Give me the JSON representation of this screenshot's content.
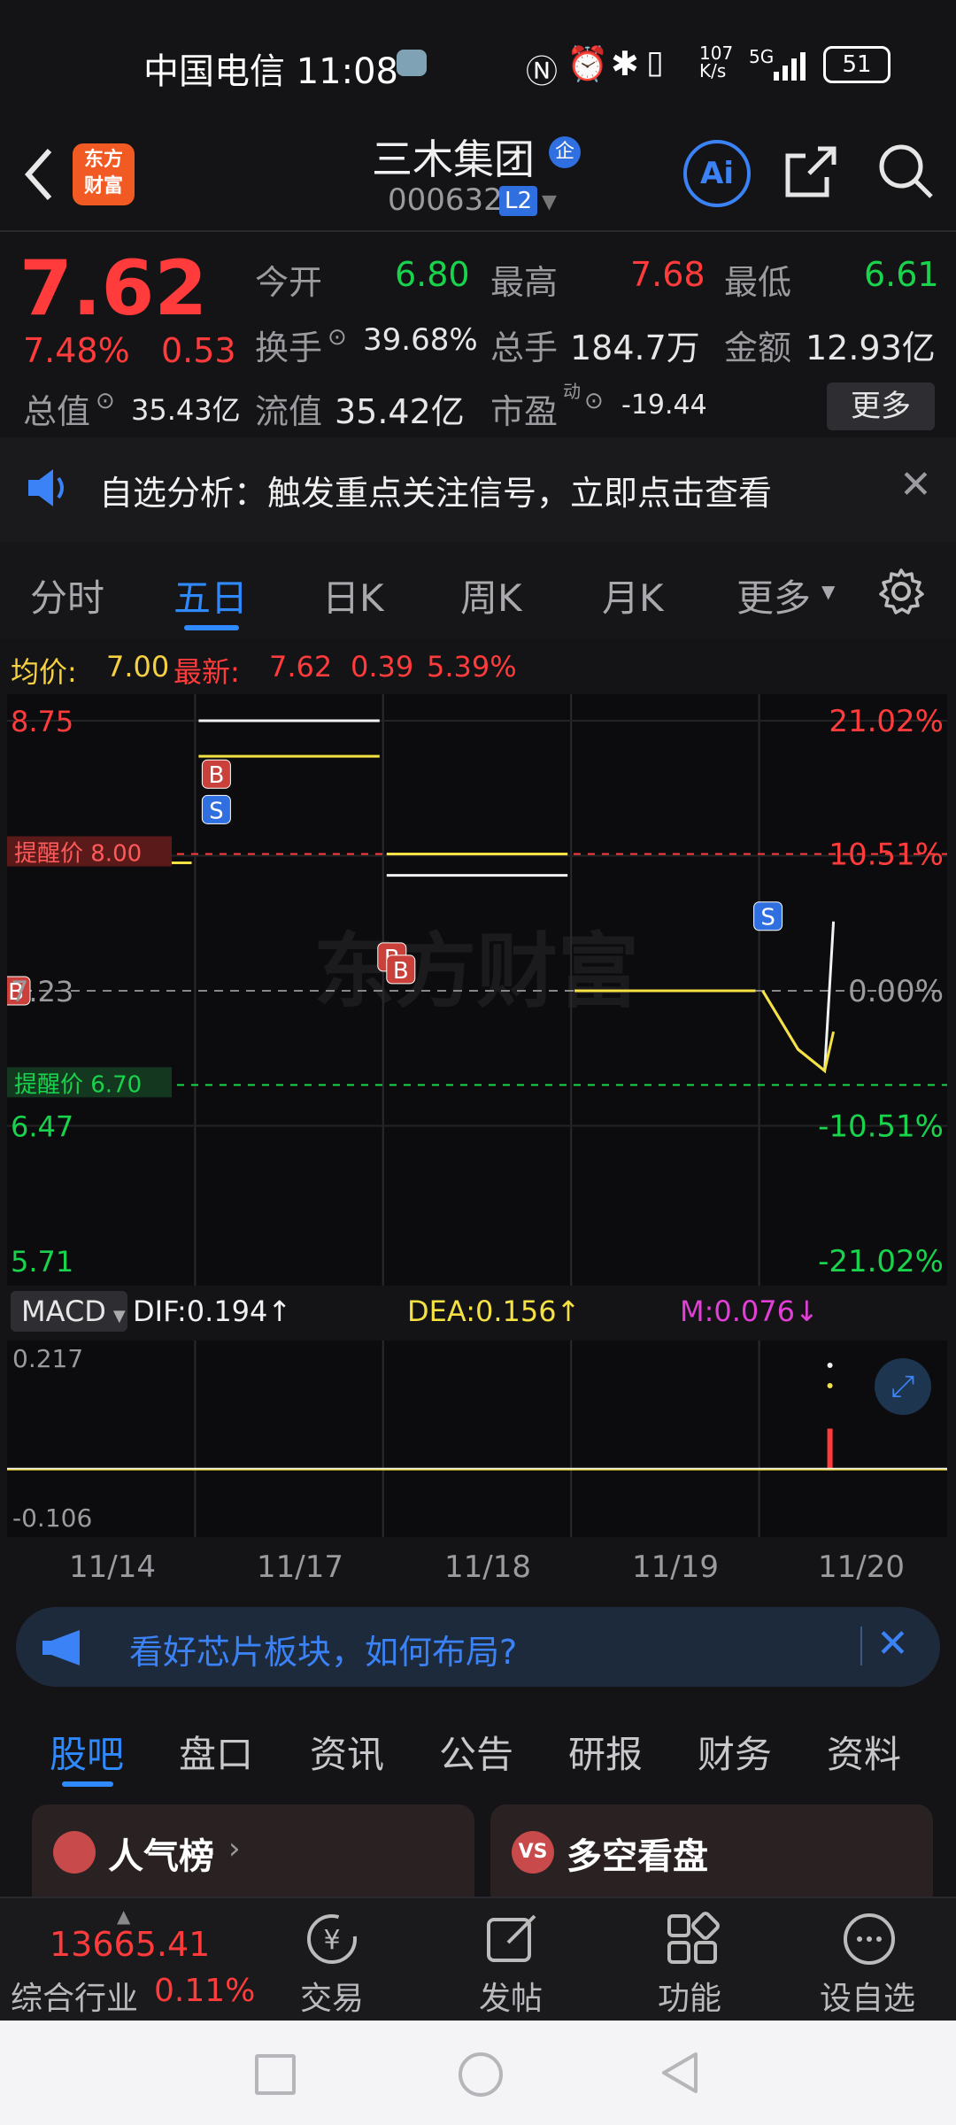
{
  "status": {
    "carrier_time": "中国电信 11:08",
    "net_speed_top": "107",
    "net_speed_bottom": "K/s",
    "net_type": "5G",
    "battery": "51"
  },
  "header": {
    "logo_text_line1": "东方",
    "logo_text_line2": "财富",
    "stock_name": "三木集团",
    "badge": "企",
    "stock_code": "000632",
    "level": "L2",
    "ai_label": "Ai"
  },
  "quote": {
    "price": "7.62",
    "change_pct": "7.48%",
    "change_amt": "0.53",
    "open_label": "今开",
    "open_value": "6.80",
    "high_label": "最高",
    "high_value": "7.68",
    "low_label": "最低",
    "low_value": "6.61",
    "turnover_label": "换手",
    "turnover_value": "39.68%",
    "volume_label": "总手",
    "volume_value": "184.7万",
    "amount_label": "金额",
    "amount_value": "12.93亿",
    "mktcap_label": "总值",
    "mktcap_value": "35.43亿",
    "float_label": "流值",
    "float_value": "35.42亿",
    "pe_label": "市盈",
    "pe_sup": "动",
    "pe_value": "-19.44",
    "more_button": "更多"
  },
  "notice": {
    "text": "自选分析：触发重点关注信号，立即点击查看"
  },
  "tabs": [
    "分时",
    "五日",
    "日K",
    "周K",
    "月K",
    "更多"
  ],
  "active_tab": "五日",
  "chart_info": {
    "avg_label": "均价:",
    "avg_value": "7.00",
    "latest_label": "最新:",
    "latest_value": "7.62",
    "latest_change": "0.39",
    "latest_pct": "5.39%"
  },
  "chart_labels": {
    "y_left": [
      "8.75",
      "7.23",
      "6.47",
      "5.71"
    ],
    "y_right": [
      "21.02%",
      "10.51%",
      "0.00%",
      "-10.51%",
      "-21.02%"
    ],
    "alert_high": "提醒价 8.00",
    "alert_low": "提醒价 6.70",
    "watermark": "东方财富"
  },
  "macd": {
    "selector": "MACD",
    "dif": "DIF:0.194↑",
    "dea": "DEA:0.156↑",
    "m": "M:0.076↓",
    "top_label": "0.217",
    "bottom_label": "-0.106"
  },
  "dates": [
    "11/14",
    "11/17",
    "11/18",
    "11/19",
    "11/20"
  ],
  "banner": {
    "text": "看好芯片板块，如何布局?"
  },
  "subtabs": [
    "股吧",
    "盘口",
    "资讯",
    "公告",
    "研报",
    "财务",
    "资料"
  ],
  "active_subtab": "股吧",
  "cards": {
    "left": "人气榜",
    "right": "多空看盘",
    "right_badge": "VS"
  },
  "bottom": {
    "index_value": "13665.41",
    "index_name": "综合行业",
    "index_pct": "0.11%",
    "items": [
      "交易",
      "发帖",
      "功能",
      "设自选"
    ]
  },
  "chart_data": {
    "type": "line",
    "title": "",
    "xlabel": "",
    "ylabel": "",
    "x": [
      "11/14",
      "11/17",
      "11/18",
      "11/19",
      "11/20"
    ],
    "ylim": [
      5.71,
      8.75
    ],
    "prev_close": 7.23,
    "series": [
      {
        "name": "最新",
        "values": [
          7.95,
          8.75,
          7.88,
          7.23,
          7.62
        ]
      },
      {
        "name": "均价",
        "values": [
          7.95,
          8.55,
          8.0,
          7.23,
          7.0
        ]
      }
    ],
    "markers": [
      {
        "day": "11/14",
        "type": "B",
        "price": 7.23
      },
      {
        "day": "11/17",
        "type": "B",
        "price": 8.45
      },
      {
        "day": "11/17",
        "type": "S",
        "price": 8.25
      },
      {
        "day": "11/18",
        "type": "B",
        "price": 7.42
      },
      {
        "day": "11/18",
        "type": "B",
        "price": 7.35
      },
      {
        "day": "11/20",
        "type": "S",
        "price": 7.65
      }
    ],
    "macd": {
      "dif": 0.194,
      "dea": 0.156,
      "m": 0.076,
      "range": [
        -0.106,
        0.217
      ]
    }
  }
}
